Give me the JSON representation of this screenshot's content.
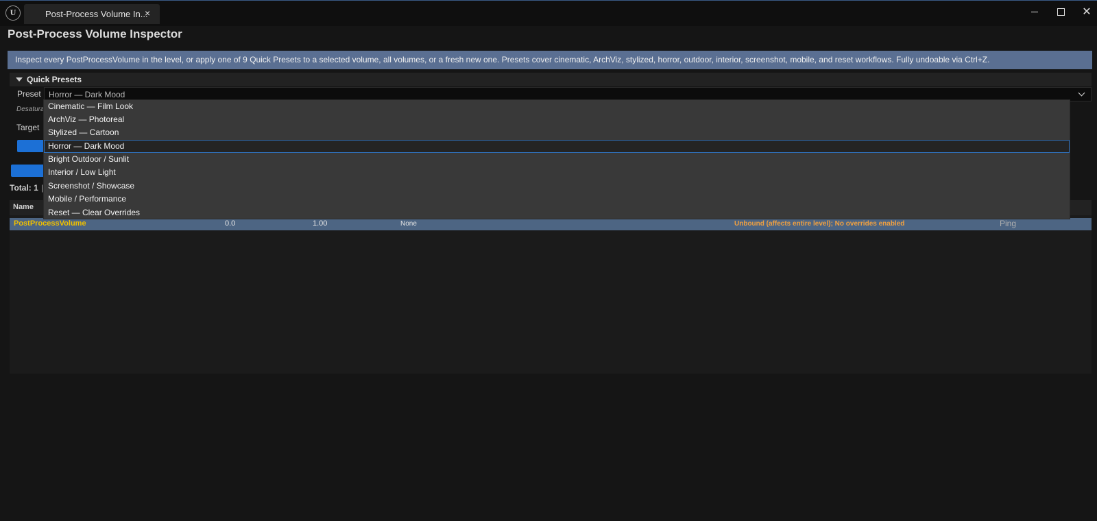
{
  "window": {
    "logo_text": "U",
    "tab_title": "Post-Process Volume In...",
    "tab_close": "×",
    "close_glyph": "✕"
  },
  "header": {
    "title": "Post-Process Volume Inspector",
    "info": "Inspect every PostProcessVolume in the level, or apply one of 9 Quick Presets to a selected volume, all volumes, or a fresh new one. Presets cover cinematic, ArchViz, stylized, horror, outdoor, interior, screenshot, mobile, and reset workflows. Fully undoable via Ctrl+Z."
  },
  "quick_presets": {
    "section_title": "Quick Presets",
    "preset_label": "Preset",
    "selected_preset": "Horror — Dark Mood",
    "description_partial": "Desatura",
    "target_label": "Target",
    "options": [
      "Cinematic — Film Look",
      "ArchViz — Photoreal",
      "Stylized — Cartoon",
      "Horror — Dark Mood",
      "Bright Outdoor / Sunlit",
      "Interior / Low Light",
      "Screenshot / Showcase",
      "Mobile / Performance",
      "Reset — Clear Overrides"
    ],
    "selected_index": 3
  },
  "summary": {
    "total": "Total: 1",
    "separator": "|"
  },
  "table": {
    "headers": [
      "Name"
    ],
    "rows": [
      {
        "name": "PostProcessVolume",
        "col_a": "0.0",
        "col_b": "1.00",
        "col_c": "None",
        "status": "Unbound (affects entire level); No overrides enabled",
        "action": "Ping"
      }
    ]
  },
  "colors": {
    "accent_blue": "#1c70d6",
    "banner": "#5a6f92",
    "row_highlight": "#4d6583",
    "name_yellow": "#f0c000",
    "status_orange": "#f0a040"
  }
}
